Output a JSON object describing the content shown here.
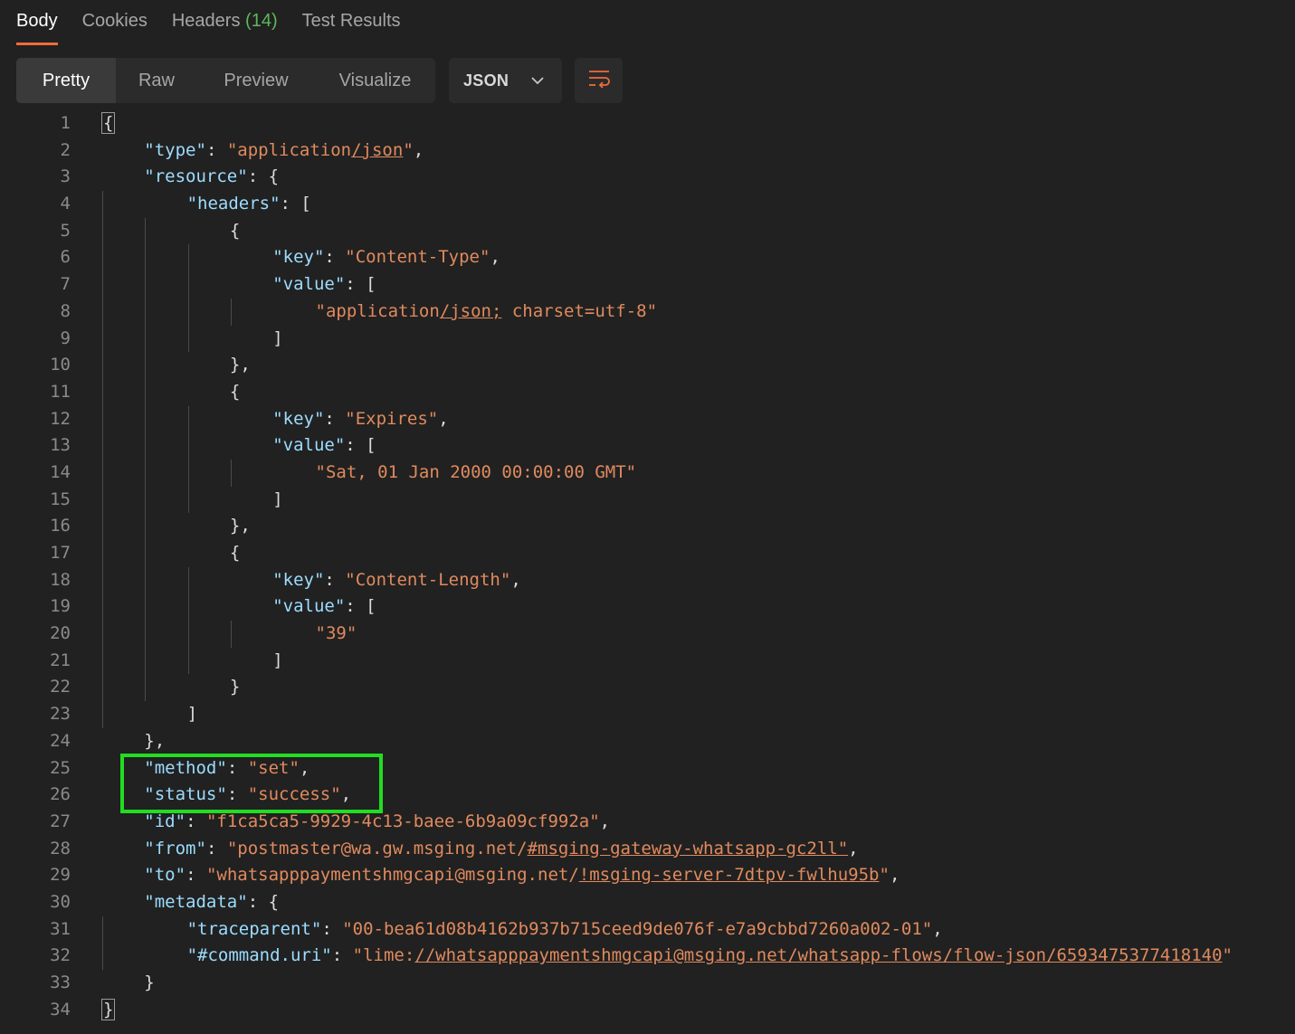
{
  "tabs": [
    {
      "label": "Body",
      "active": true
    },
    {
      "label": "Cookies"
    },
    {
      "label": "Headers",
      "count": "(14)"
    },
    {
      "label": "Test Results"
    }
  ],
  "view_modes": [
    "Pretty",
    "Raw",
    "Preview",
    "Visualize"
  ],
  "active_view_mode": "Pretty",
  "format": {
    "label": "JSON",
    "icon": "chevron-down-icon"
  },
  "wrap_icon": "wrap-lines-icon",
  "colors": {
    "accent": "#f26b3a",
    "count": "#5cb85c",
    "key": "#9cdcfe",
    "string": "#e08a5e",
    "highlight_box": "#22dd22"
  },
  "editor": {
    "line_numbers": [
      "1",
      "2",
      "3",
      "4",
      "5",
      "6",
      "7",
      "8",
      "9",
      "10",
      "11",
      "12",
      "13",
      "14",
      "15",
      "16",
      "17",
      "18",
      "19",
      "20",
      "21",
      "22",
      "23",
      "24",
      "25",
      "26",
      "27",
      "28",
      "29",
      "30",
      "31",
      "32",
      "33",
      "34"
    ],
    "lines": [
      [
        {
          "t": "{",
          "c": "box"
        }
      ],
      [
        {
          "t": "\"type\"",
          "c": "k"
        },
        {
          "t": ": ",
          "c": "p"
        },
        {
          "t": "\"application/json\"",
          "c": "s"
        },
        {
          "t": ",",
          "c": "p"
        }
      ],
      [
        {
          "t": "\"resource\"",
          "c": "k"
        },
        {
          "t": ": {",
          "c": "p"
        }
      ],
      [
        {
          "t": "\"headers\"",
          "c": "k"
        },
        {
          "t": ": [",
          "c": "p"
        }
      ],
      [
        {
          "t": "{",
          "c": "p"
        }
      ],
      [
        {
          "t": "\"key\"",
          "c": "k"
        },
        {
          "t": ": ",
          "c": "p"
        },
        {
          "t": "\"Content-Type\"",
          "c": "s"
        },
        {
          "t": ",",
          "c": "p"
        }
      ],
      [
        {
          "t": "\"value\"",
          "c": "k"
        },
        {
          "t": ": [",
          "c": "p"
        }
      ],
      [
        {
          "t": "\"application/json; charset=utf-8\"",
          "c": "s"
        }
      ],
      [
        {
          "t": "]",
          "c": "p"
        }
      ],
      [
        {
          "t": "},",
          "c": "p"
        }
      ],
      [
        {
          "t": "{",
          "c": "p"
        }
      ],
      [
        {
          "t": "\"key\"",
          "c": "k"
        },
        {
          "t": ": ",
          "c": "p"
        },
        {
          "t": "\"Expires\"",
          "c": "s"
        },
        {
          "t": ",",
          "c": "p"
        }
      ],
      [
        {
          "t": "\"value\"",
          "c": "k"
        },
        {
          "t": ": [",
          "c": "p"
        }
      ],
      [
        {
          "t": "\"Sat, 01 Jan 2000 00:00:00 GMT\"",
          "c": "s"
        }
      ],
      [
        {
          "t": "]",
          "c": "p"
        }
      ],
      [
        {
          "t": "},",
          "c": "p"
        }
      ],
      [
        {
          "t": "{",
          "c": "p"
        }
      ],
      [
        {
          "t": "\"key\"",
          "c": "k"
        },
        {
          "t": ": ",
          "c": "p"
        },
        {
          "t": "\"Content-Length\"",
          "c": "s"
        },
        {
          "t": ",",
          "c": "p"
        }
      ],
      [
        {
          "t": "\"value\"",
          "c": "k"
        },
        {
          "t": ": [",
          "c": "p"
        }
      ],
      [
        {
          "t": "\"39\"",
          "c": "s"
        }
      ],
      [
        {
          "t": "]",
          "c": "p"
        }
      ],
      [
        {
          "t": "}",
          "c": "p"
        }
      ],
      [
        {
          "t": "]",
          "c": "p"
        }
      ],
      [
        {
          "t": "},",
          "c": "p"
        }
      ],
      [
        {
          "t": "\"method\"",
          "c": "k"
        },
        {
          "t": ": ",
          "c": "p"
        },
        {
          "t": "\"set\"",
          "c": "s"
        },
        {
          "t": ",",
          "c": "p"
        }
      ],
      [
        {
          "t": "\"status\"",
          "c": "k"
        },
        {
          "t": ": ",
          "c": "p"
        },
        {
          "t": "\"success\"",
          "c": "s"
        },
        {
          "t": ",",
          "c": "p"
        }
      ],
      [
        {
          "t": "\"id\"",
          "c": "k"
        },
        {
          "t": ": ",
          "c": "p"
        },
        {
          "t": "\"f1ca5ca5-9929-4c13-baee-6b9a09cf992a\"",
          "c": "s"
        },
        {
          "t": ",",
          "c": "p"
        }
      ],
      [
        {
          "t": "\"from\"",
          "c": "k"
        },
        {
          "t": ": ",
          "c": "p"
        },
        {
          "t": "\"postmaster@wa.gw.msging.net/#msging-gateway-whatsapp-gc2ll\"",
          "c": "s"
        },
        {
          "t": ",",
          "c": "p"
        }
      ],
      [
        {
          "t": "\"to\"",
          "c": "k"
        },
        {
          "t": ": ",
          "c": "p"
        },
        {
          "t": "\"whatsapppaymentshmgcapi@msging.net/!msging-server-7dtpv-fwlhu95b\"",
          "c": "s"
        },
        {
          "t": ",",
          "c": "p"
        }
      ],
      [
        {
          "t": "\"metadata\"",
          "c": "k"
        },
        {
          "t": ": {",
          "c": "p"
        }
      ],
      [
        {
          "t": "\"traceparent\"",
          "c": "k"
        },
        {
          "t": ": ",
          "c": "p"
        },
        {
          "t": "\"00-bea61d08b4162b937b715ceed9de076f-e7a9cbbd7260a002-01\"",
          "c": "s"
        },
        {
          "t": ",",
          "c": "p"
        }
      ],
      [
        {
          "t": "\"#command.uri\"",
          "c": "k"
        },
        {
          "t": ": ",
          "c": "p"
        },
        {
          "t": "\"lime://whatsapppaymentshmgcapi@msging.net/whatsapp-flows/flow-json/6593475377418140\"",
          "c": "s"
        }
      ],
      [
        {
          "t": "}",
          "c": "p"
        }
      ],
      [
        {
          "t": "}",
          "c": "box"
        }
      ]
    ]
  }
}
